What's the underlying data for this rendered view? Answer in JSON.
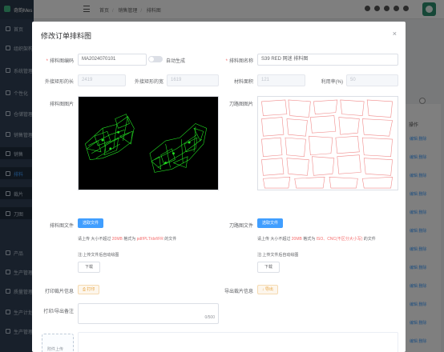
{
  "app": {
    "name": "奇韵Mes"
  },
  "sidebar": {
    "items": [
      {
        "label": "首页"
      },
      {
        "label": "组织架构"
      },
      {
        "label": "系统管理"
      },
      {
        "label": "个性化"
      },
      {
        "label": "仓储管理"
      },
      {
        "label": "销售管理"
      },
      {
        "label": "销售"
      },
      {
        "label": "排料"
      },
      {
        "label": "裁片"
      },
      {
        "label": "刀图"
      },
      {
        "label": "产品"
      },
      {
        "label": "生产管理"
      },
      {
        "label": "质量管理"
      },
      {
        "label": "生产计划"
      },
      {
        "label": "生产管理"
      }
    ]
  },
  "breadcrumb": [
    "首页",
    "销售管理",
    "排料图"
  ],
  "background": {
    "op_header": "操作",
    "row_actions": [
      "编辑",
      "删除"
    ]
  },
  "dialog": {
    "title": "修改订单排料图",
    "close": "×",
    "code_label": "排料图编码",
    "code_value": "MA2024070101",
    "auto_label": "自动生成",
    "name_label": "排料图名称",
    "name_value": "S39 RED 网迷 排料图",
    "outer_len_label": "外接矩形的长",
    "outer_len_value": "2419",
    "outer_wid_label": "外接矩形的宽",
    "outer_wid_value": "1619",
    "area_label": "材料面积",
    "area_value": "121",
    "util_label": "利用率(%)",
    "util_value": "50",
    "nest_image_label": "排料图图片",
    "knife_image_label": "刀路图图片",
    "nest_file_label": "排料图文件",
    "knife_file_label": "刀路图文件",
    "select_file": "选取文件",
    "nest_tip_a": "请上传 大小不超过 ",
    "nest_tip_size": "20MB",
    "nest_tip_b": " 格式为 ",
    "nest_tip_formats": "pdf/PLT/dxf/FR",
    "nest_tip_c": " 的文件",
    "knife_tip_a": "请上传 大小不超过 ",
    "knife_tip_size": "20MB",
    "knife_tip_b": " 格式为 ",
    "knife_tip_formats": "ISO、CNC(不区分大小写)",
    "knife_tip_c": " 的文件",
    "note": "注:上传文件后自动绘图",
    "download": "下载",
    "print_label": "打印裁片信息",
    "print_btn": "打印",
    "export_label": "导出裁片信息",
    "export_btn": "导出",
    "remark_label": "打印/导出备注",
    "remark_count": "0/500",
    "upload_label": "附件上传"
  }
}
